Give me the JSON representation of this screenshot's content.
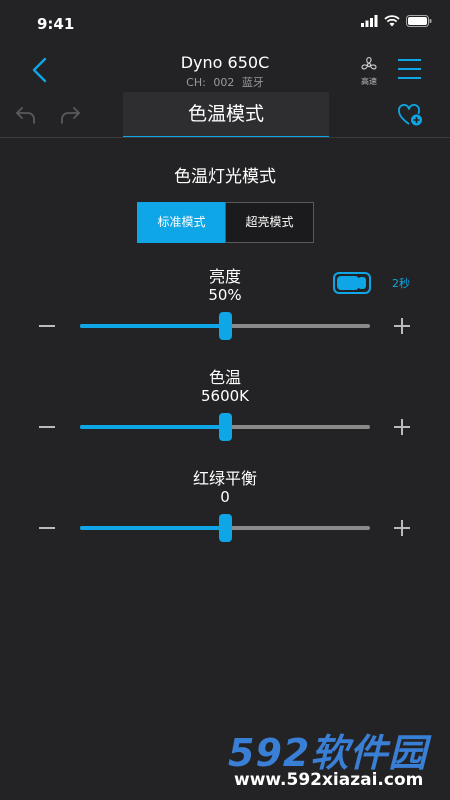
{
  "status_bar": {
    "time": "9:41"
  },
  "header": {
    "device_name": "Dyno 650C",
    "channel": "CH: 002",
    "connection": "蓝牙",
    "fan_label": "高速"
  },
  "tabbar": {
    "active_tab": "色温模式"
  },
  "content": {
    "section_title": "色温灯光模式",
    "modes": [
      {
        "label": "标准模式",
        "selected": true
      },
      {
        "label": "超亮模式",
        "selected": false
      }
    ],
    "fade_toggle": {
      "on": true,
      "time_label": "2秒"
    },
    "sliders": [
      {
        "label": "亮度",
        "value_text": "50%",
        "position": 0.5
      },
      {
        "label": "色温",
        "value_text": "5600K",
        "position": 0.5
      },
      {
        "label": "红绿平衡",
        "value_text": "0",
        "position": 0.5
      }
    ]
  },
  "watermark": {
    "brand": "592软件园",
    "url": "www.592xiazai.com"
  },
  "colors": {
    "accent": "#0ea6e6",
    "background": "#232325",
    "track": "#8a8a8a"
  }
}
